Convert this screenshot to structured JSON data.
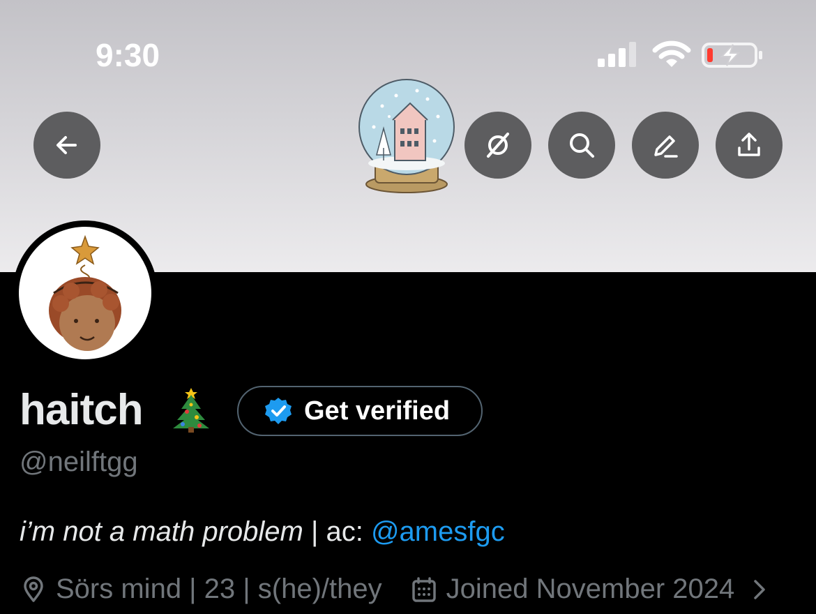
{
  "status_bar": {
    "time": "9:30",
    "signal_icon": "cellular-signal-icon",
    "wifi_icon": "wifi-icon",
    "battery_icon": "battery-charging-icon"
  },
  "header": {
    "back_icon": "arrow-left-icon",
    "grok_icon": "grok-icon",
    "search_icon": "search-icon",
    "edit_icon": "edit-icon",
    "share_icon": "share-icon"
  },
  "profile": {
    "display_name": "haitch",
    "handle": "@neilftgg",
    "verify_button": "Get verified",
    "bio_text": "i’m not a math problem",
    "bio_separator": " | ac: ",
    "bio_mention": "@amesfgc",
    "location": "Sörs mind | 23 | s(he)/they",
    "joined": "Joined November 2024"
  },
  "colors": {
    "accent": "#1d9bf0",
    "muted": "#71767b",
    "background": "#000000",
    "button_bg": "#5d5d5f"
  }
}
